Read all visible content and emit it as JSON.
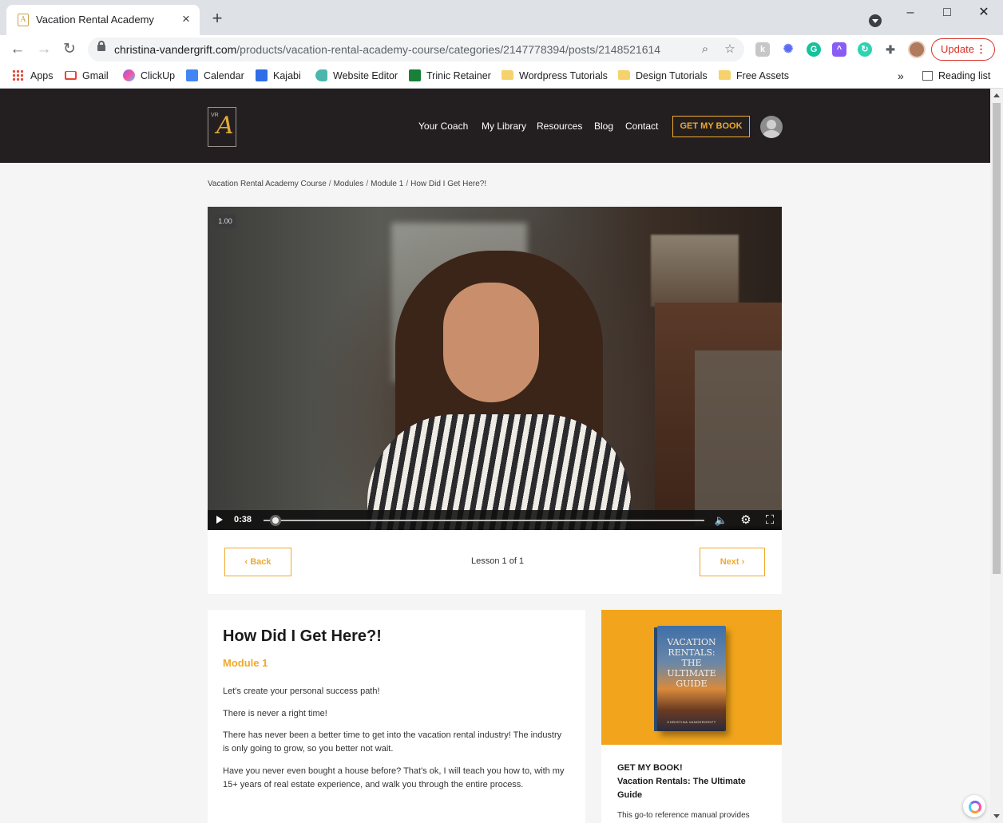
{
  "browser": {
    "tab_title": "Vacation Rental Academy",
    "url_host": "christina-vandergrift.com",
    "url_path": "/products/vacation-rental-academy-course/categories/2147778394/posts/2148521614",
    "update_label": "Update",
    "bookmarks": [
      {
        "label": "Apps",
        "icon": "apps-grid-icon"
      },
      {
        "label": "Gmail",
        "icon": "gmail-icon",
        "color": "#ea4335"
      },
      {
        "label": "ClickUp",
        "icon": "clickup-icon",
        "color": "#7b68ee"
      },
      {
        "label": "Calendar",
        "icon": "calendar-icon",
        "color": "#4285f4"
      },
      {
        "label": "Kajabi",
        "icon": "kajabi-icon",
        "color": "#2e6ee6"
      },
      {
        "label": "Website Editor",
        "icon": "website-editor-icon",
        "color": "#4db6ac"
      },
      {
        "label": "Trinic Retainer",
        "icon": "sheets-icon",
        "color": "#188038"
      },
      {
        "label": "Wordpress Tutorials",
        "icon": "folder-icon",
        "color": "#f5d26b"
      },
      {
        "label": "Design Tutorials",
        "icon": "folder-icon",
        "color": "#f5d26b"
      },
      {
        "label": "Free Assets",
        "icon": "folder-icon",
        "color": "#f5d26b"
      }
    ],
    "reading_list": "Reading list"
  },
  "site": {
    "logo_letters": "VR",
    "logo_mark": "A",
    "nav": [
      "Your Coach",
      "My Library",
      "Resources",
      "Blog",
      "Contact"
    ],
    "cta": "GET MY BOOK",
    "accent": "#f0a92d",
    "header_bg": "#231f20"
  },
  "breadcrumb": [
    "Vacation Rental Academy Course",
    "Modules",
    "Module 1",
    "How Did I Get Here?!"
  ],
  "video": {
    "speed": "1.00",
    "time": "0:38",
    "progress": 0.02
  },
  "lesson_nav": {
    "back": "Back",
    "next": "Next",
    "count": "Lesson 1 of 1"
  },
  "post": {
    "title": "How Did I Get Here?!",
    "module": "Module 1",
    "paragraphs": [
      "Let's create your personal success path!",
      "There is never a right time!",
      "There has never been a better time to get into the vacation rental industry! The industry is only going to grow, so you better not wait.",
      "Have you never even bought a house before? That's ok, I will teach you how to, with my 15+ years of real estate experience, and walk you through the entire process."
    ]
  },
  "sidebar": {
    "book_cover_title": "VACATION RENTALS: THE ULTIMATE GUIDE",
    "book_cover_author": "CHRISTINA VANDERGRIFT",
    "heading_line1": "GET MY BOOK!",
    "heading_line2": "Vacation Rentals: The Ultimate Guide",
    "text": "This go-to reference manual provides"
  }
}
